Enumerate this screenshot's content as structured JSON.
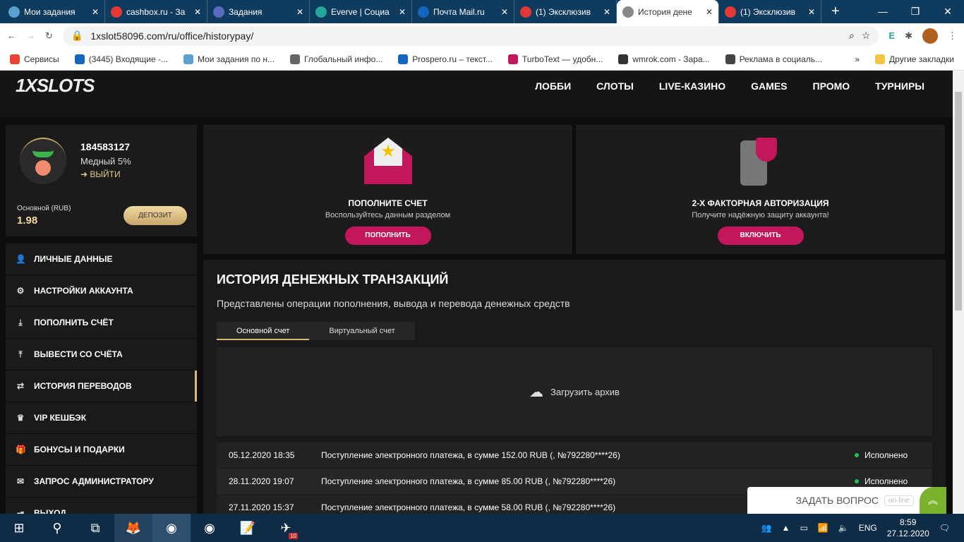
{
  "browser": {
    "tabs": [
      {
        "label": "Мои задания",
        "color": "#5aa0d0"
      },
      {
        "label": "cashbox.ru - За",
        "color": "#e53935"
      },
      {
        "label": "Задания",
        "color": "#5c6bc0"
      },
      {
        "label": "Everve | Социа",
        "color": "#26a69a"
      },
      {
        "label": "Почта Mail.ru",
        "color": "#1565c0"
      },
      {
        "label": "(1) Эксклюзив",
        "color": "#e53935"
      },
      {
        "label": "История дене",
        "color": "#888888"
      },
      {
        "label": "(1) Эксклюзив",
        "color": "#e53935"
      }
    ],
    "url": "1xslot58096.com/ru/office/historypay/",
    "bookmarks": [
      "Сервисы",
      "(3445) Входящие -...",
      "Мои задания по н...",
      "Глобальный инфо...",
      "Prospero.ru – текст...",
      "TurboText — удобн...",
      "wmrok.com - Зара...",
      "Реклама в социаль..."
    ],
    "other_bookmarks": "Другие закладки"
  },
  "site": {
    "logo": "1XSLOTS",
    "nav": [
      "ЛОББИ",
      "СЛОТЫ",
      "LIVE-КАЗИНО",
      "GAMES",
      "ПРОМО",
      "ТУРНИРЫ"
    ]
  },
  "profile": {
    "id": "184583127",
    "level": "Медный 5%",
    "logout": "ВЫЙТИ",
    "balance_label": "Основной (RUB)",
    "balance": "1.98",
    "deposit": "ДЕПОЗИТ"
  },
  "menu": [
    "ЛИЧНЫЕ ДАННЫЕ",
    "НАСТРОЙКИ АККАУНТА",
    "ПОПОЛНИТЬ СЧЁТ",
    "ВЫВЕСТИ СО СЧЁТА",
    "ИСТОРИЯ ПЕРЕВОДОВ",
    "VIP КЕШБЭК",
    "БОНУСЫ И ПОДАРКИ",
    "ЗАПРОС АДМИНИСТРАТОРУ",
    "ВЫХОД"
  ],
  "cards": [
    {
      "title": "ПОПОЛНИТЕ СЧЕТ",
      "text": "Воспользуйтесь данным разделом",
      "button": "ПОПОЛНИТЬ"
    },
    {
      "title": "2-Х ФАКТОРНАЯ АВТОРИЗАЦИЯ",
      "text": "Получите надёжную защиту аккаунта!",
      "button": "ВКЛЮЧИТЬ"
    }
  ],
  "history": {
    "title": "ИСТОРИЯ ДЕНЕЖНЫХ ТРАНЗАКЦИЙ",
    "subtitle": "Представлены операции пополнения, вывода и перевода денежных средств",
    "tabs": [
      "Основной счет",
      "Виртуальный счет"
    ],
    "archive": "Загрузить архив",
    "rows": [
      {
        "date": "05.12.2020 18:35",
        "text": "Поступление электронного платежа, в сумме 152.00 RUB (, №792280****26)",
        "status": "Исполнено"
      },
      {
        "date": "28.11.2020 19:07",
        "text": "Поступление электронного платежа, в сумме 85.00 RUB (, №792280****26)",
        "status": "Исполнено"
      },
      {
        "date": "27.11.2020 15:37",
        "text": "Поступление электронного платежа, в сумме 58.00 RUB (, №792280****26)",
        "status": ""
      }
    ]
  },
  "chat": {
    "label": "ЗАДАТЬ ВОПРОС",
    "badge": "on-line"
  },
  "taskbar": {
    "lang": "ENG",
    "time": "8:59",
    "date": "27.12.2020",
    "telegram_badge": "10"
  }
}
